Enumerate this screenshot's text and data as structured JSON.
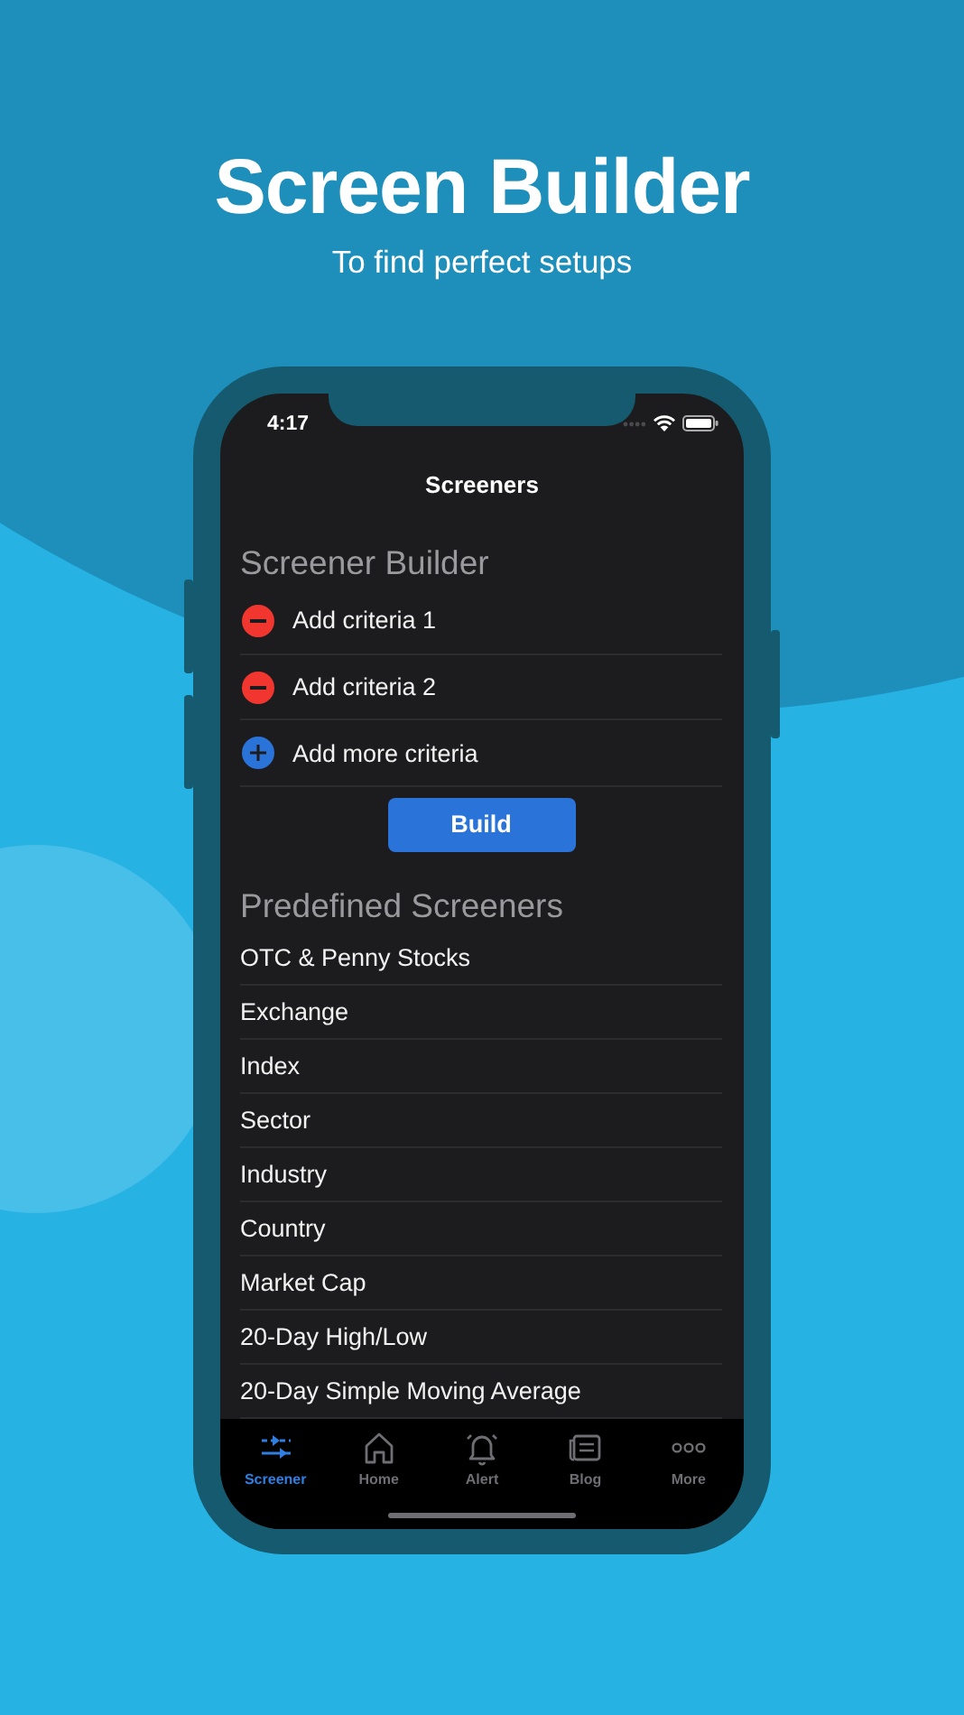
{
  "hero": {
    "title": "Screen Builder",
    "subtitle": "To find perfect setups"
  },
  "status_bar": {
    "time": "4:17"
  },
  "nav": {
    "title": "Screeners"
  },
  "builder": {
    "title": "Screener Builder",
    "criteria": [
      {
        "kind": "remove",
        "label": "Add criteria 1"
      },
      {
        "kind": "remove",
        "label": "Add criteria 2"
      },
      {
        "kind": "add",
        "label": "Add more criteria"
      }
    ],
    "button": "Build"
  },
  "predefined": {
    "title": "Predefined Screeners",
    "items": [
      "OTC & Penny Stocks",
      "Exchange",
      "Index",
      "Sector",
      "Industry",
      "Country",
      "Market Cap",
      "20-Day High/Low",
      "20-Day Simple Moving Average"
    ]
  },
  "tabs": [
    {
      "kind": "screener",
      "label": "Screener",
      "selected": true
    },
    {
      "kind": "home",
      "label": "Home",
      "selected": false
    },
    {
      "kind": "alert",
      "label": "Alert",
      "selected": false
    },
    {
      "kind": "blog",
      "label": "Blog",
      "selected": false
    },
    {
      "kind": "more",
      "label": "More",
      "selected": false
    }
  ]
}
